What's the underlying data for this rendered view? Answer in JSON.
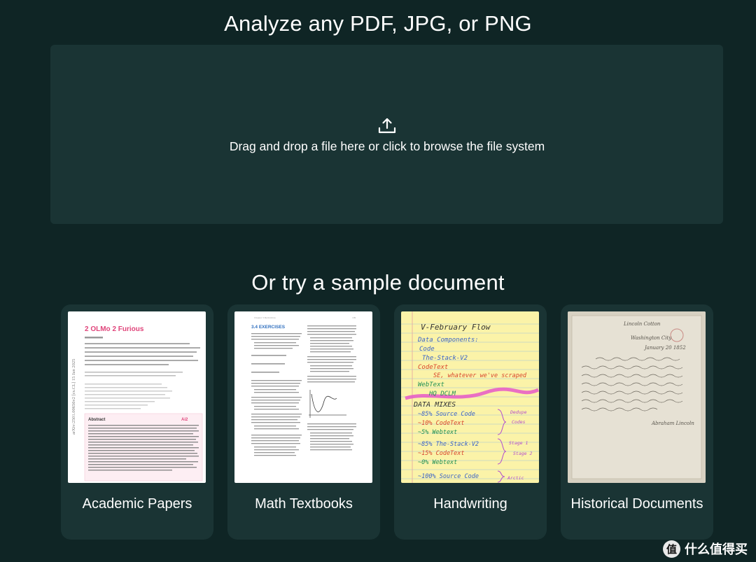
{
  "upload": {
    "title": "Analyze any PDF, JPG, or PNG",
    "dropzone_text": "Drag and drop a file here or click to browse the file system",
    "icon": "upload-icon"
  },
  "samples": {
    "title": "Or try a sample document",
    "cards": [
      {
        "label": "Academic Papers"
      },
      {
        "label": "Math Textbooks"
      },
      {
        "label": "Handwriting"
      },
      {
        "label": "Historical Documents"
      }
    ]
  },
  "thumbnails": {
    "paper": {
      "title": "2 OLMo 2 Furious",
      "abstract_heading": "Abstract",
      "side_text": "arXiv:2501.00656v2 [cs.CL] 15 Jan 2025",
      "logo_text": "Ai2"
    },
    "math": {
      "heading": "3.4 EXERCISES",
      "header_left": "Chapter 3 Derivatives",
      "page_number": "109"
    },
    "handwriting": {
      "lines": [
        "V-February Flow",
        "Data Components:",
        "Code",
        "The-Stack-V2",
        "CodeText",
        "SE, whatever we've scraped",
        "WebText",
        "HQ DCLM",
        "DATA MIXES",
        "~85% Source Code",
        "~10% CodeText",
        "~5% Webtext",
        "~85% The-Stack-V2",
        "~15% CodeText",
        "~0% Webtext",
        "~100% Source Code",
        "Stage 1",
        "Stage 2",
        "Arctic",
        "Dedupe",
        "Codes"
      ]
    },
    "historical": {
      "lines": [
        "Lincoln Cotton",
        "Washington City",
        "January 20 1852",
        "Abraham Lincoln"
      ]
    },
    "colors": {
      "background": "#0f2525",
      "panel": "#1a3434",
      "paper_pink": "#e0457b",
      "hand_blue": "#3a63c8",
      "hand_red": "#d8452e",
      "hand_green": "#1f8f56",
      "hand_purple": "#b04bd0",
      "hand_highlight": "#e657c8"
    }
  },
  "watermark": {
    "badge": "值",
    "text": "什么值得买"
  }
}
